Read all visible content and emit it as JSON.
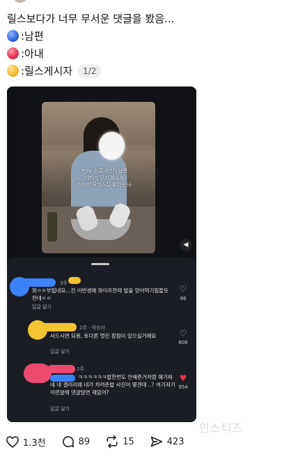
{
  "post": {
    "title": "릴스보다가 너무 무서운 댓글을 봤음...",
    "legend": [
      {
        "icon": "blue-circle-icon",
        "color": "#2f67d8",
        "label": ":남편"
      },
      {
        "icon": "red-circle-icon",
        "color": "#e23352",
        "label": ":아내"
      },
      {
        "icon": "yellow-circle-icon",
        "color": "#f1b92b",
        "label": ":릴스게시자"
      }
    ],
    "image_counter": "1/2"
  },
  "video": {
    "caption": "POV: 신혼 3년차 남편\n 대타가 오기 방부서\n 허비한 요리스킬 펼치는 나"
  },
  "comments": [
    {
      "meta": "3주",
      "text": "와ㅇㅇ부럽네요...전 이번생에 와이프한테 밥을 얻어먹기힘들듯한데ㅇㅇ",
      "reply": "답글 달기",
      "likes": "98",
      "name_color": "#3b82f6",
      "liked": false
    },
    {
      "meta": "2주 · 작성자",
      "text": "사드시면 되용, 토다론 멋진 장점이 있으실거에요",
      "reply": "답글 달기",
      "likes": "606",
      "name_color": "#f4c431",
      "liked": false
    },
    {
      "meta": "2주",
      "text": "ㅋㅋㅋㅋㅋㅋ밥한번도 안해준거처럼 얘기하네 내 갤러리에 내가 차려준밥 사진이 몇갠데 ..? 여기저기 이런글에 댓글달면 재밌어?",
      "reply": "답글 달기",
      "likes": "954",
      "name_color": "#ec4a6f",
      "liked": true
    }
  ],
  "actions": {
    "like_count": "1.3천",
    "comment_count": "89",
    "repost_count": "15",
    "share_count": "423"
  },
  "watermark": "인스티즈"
}
